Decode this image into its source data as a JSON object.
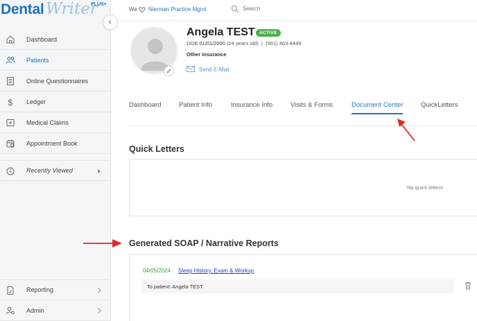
{
  "logo": {
    "brand_main": "Dental",
    "brand_script": "Writer",
    "badge": "PLUS+"
  },
  "sidebar": {
    "items": [
      {
        "label": "Dashboard",
        "icon": "home-icon"
      },
      {
        "label": "Patients",
        "icon": "patients-icon",
        "active": true
      },
      {
        "label": "Online Questionnaires",
        "icon": "questionnaire-icon"
      },
      {
        "label": "Ledger",
        "icon": "dollar-icon"
      },
      {
        "label": "Medical Claims",
        "icon": "claims-icon"
      },
      {
        "label": "Appointment Book",
        "icon": "calendar-icon"
      },
      {
        "label": "Recently Viewed",
        "icon": "clock-icon"
      },
      {
        "label": "Reporting",
        "icon": "report-icon"
      },
      {
        "label": "Admin",
        "icon": "admin-icon"
      }
    ]
  },
  "topbar": {
    "we_text": "We",
    "practice": "Nierman Practice Mgmt",
    "search_placeholder": "Search"
  },
  "patient": {
    "name": "Angela TEST",
    "status": "ACTIVE",
    "dob_label": "DOB",
    "dob": "01/01/2000",
    "age": "(24 years old)",
    "phone": "(561) 463-4449",
    "insurance": "Other insurance",
    "email_action": "Send E-Mail"
  },
  "tabs": [
    {
      "label": "Dashboard"
    },
    {
      "label": "Patient Info"
    },
    {
      "label": "Insurance Info"
    },
    {
      "label": "Visits & Forms"
    },
    {
      "label": "Document Center",
      "active": true
    },
    {
      "label": "QuickLetters"
    }
  ],
  "quick_letters": {
    "title": "Quick Letters",
    "empty": "No quick letters"
  },
  "soap": {
    "title": "Generated SOAP / Narrative Reports",
    "reports": [
      {
        "date": "04/05/2024",
        "title": "Sleep History, Exam & Workup",
        "recipient": "To patient: Angela TEST"
      }
    ]
  },
  "colors": {
    "brand": "#1e73be",
    "active_badge": "#4caf50",
    "annotation": "#e02b20"
  }
}
